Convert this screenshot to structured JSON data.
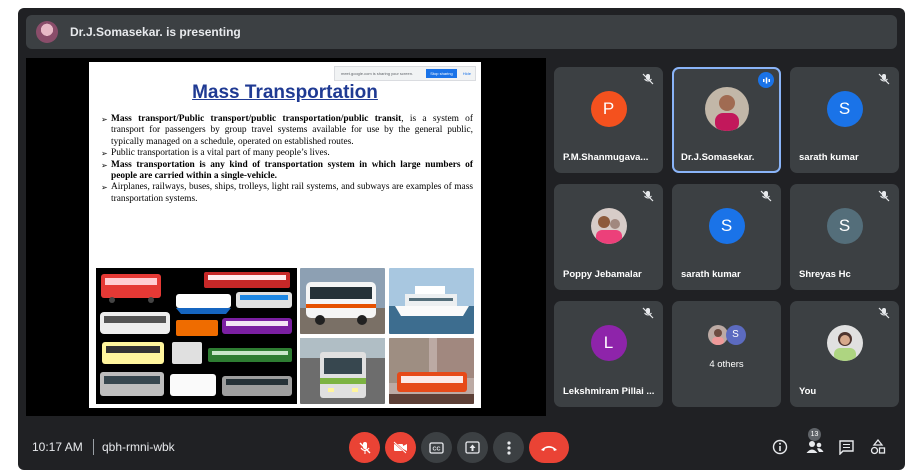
{
  "topbar": {
    "presenter_text": "Dr.J.Somasekar. is presenting"
  },
  "share_bar": {
    "text": "meet.google.com is sharing your screen.",
    "stop_label": "Stop sharing",
    "hide_label": "Hide"
  },
  "slide": {
    "title": "Mass Transportation",
    "bullets": {
      "b1_bold": "Mass transport/Public transport/public transportation/public transit",
      "b1_rest": ", is a system of transport for passengers by group travel systems available for use by the general public, typically managed on a schedule, operated on established routes.",
      "b2": "Public transportation is a vital part of many people’s lives.",
      "b3_bold": "Mass transportation is any kind of transportation system in which large numbers of people are carried within a single-vehicle",
      "b3_end": ".",
      "b4": "Airplanes, railways, buses, ships, trolleys, light rail systems, and subways are examples of mass transportation systems."
    }
  },
  "participants": [
    {
      "name": "P.M.Shanmugava...",
      "initial": "P",
      "color": "#f4511e",
      "muted": true
    },
    {
      "name": "Dr.J.Somasekar.",
      "initial": "",
      "color": "",
      "muted": false,
      "speaking": true,
      "photo": true
    },
    {
      "name": "sarath kumar",
      "initial": "S",
      "color": "#1a73e8",
      "muted": true
    },
    {
      "name": "Poppy Jebamalar",
      "initial": "",
      "photo": true,
      "muted": true
    },
    {
      "name": "sarath kumar",
      "initial": "S",
      "color": "#1a73e8",
      "muted": true
    },
    {
      "name": "Shreyas Hc",
      "initial": "S",
      "color": "#546e7a",
      "muted": true
    },
    {
      "name": "Lekshmiram Pillai ...",
      "initial": "L",
      "color": "#8e24aa",
      "muted": true
    },
    {
      "name": "4 others",
      "initial": "S",
      "color": "#5c6bc0",
      "group": true
    },
    {
      "name": "You",
      "photo": true,
      "muted": true
    }
  ],
  "bottom": {
    "time": "10:17 AM",
    "meeting_code": "qbh-rmni-wbk",
    "people_count": "13"
  },
  "icons": {
    "mic_off": "mic-off-icon",
    "cam_off": "camera-off-icon",
    "captions": "captions-icon",
    "present": "present-icon",
    "more": "more-vert-icon",
    "hangup": "hangup-icon",
    "info": "info-icon",
    "people": "people-icon",
    "chat": "chat-icon",
    "activities": "activities-icon"
  }
}
